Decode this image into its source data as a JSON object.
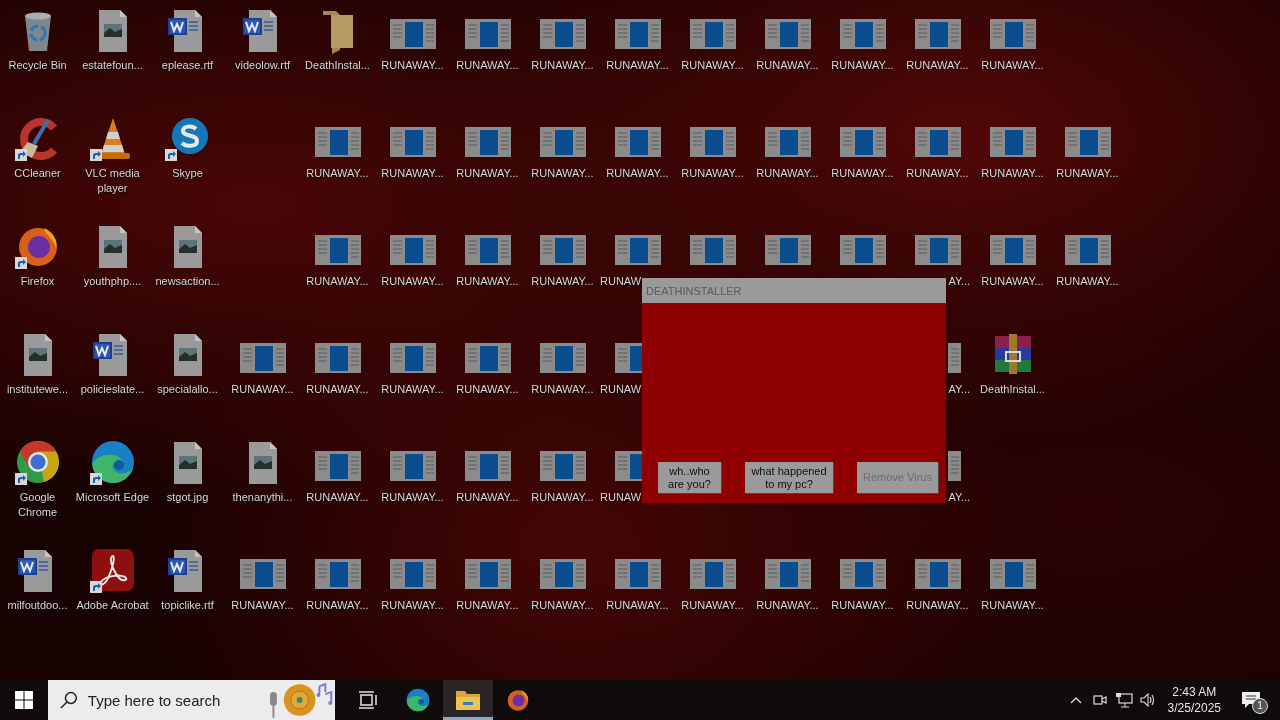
{
  "desktop": {
    "rows": [
      [
        {
          "kind": "recycle",
          "label": "Recycle Bin"
        },
        {
          "kind": "image",
          "label": "estatefoun..."
        },
        {
          "kind": "word",
          "label": "eplease.rtf"
        },
        {
          "kind": "word",
          "label": "videolow.rtf"
        },
        {
          "kind": "folder",
          "label": "DeathInstal..."
        },
        {
          "kind": "app-window",
          "label": "RUNAWAY..."
        },
        {
          "kind": "app-window",
          "label": "RUNAWAY..."
        },
        {
          "kind": "app-window",
          "label": "RUNAWAY..."
        },
        {
          "kind": "app-window",
          "label": "RUNAWAY..."
        },
        {
          "kind": "app-window",
          "label": "RUNAWAY..."
        },
        {
          "kind": "app-window",
          "label": "RUNAWAY..."
        },
        {
          "kind": "app-window",
          "label": "RUNAWAY..."
        },
        {
          "kind": "app-window",
          "label": "RUNAWAY..."
        },
        {
          "kind": "app-window",
          "label": "RUNAWAY..."
        }
      ],
      [
        {
          "kind": "ccleaner",
          "label": "CCleaner",
          "shortcut": true
        },
        {
          "kind": "vlc",
          "label": "VLC media player",
          "shortcut": true
        },
        {
          "kind": "skype",
          "label": "Skype",
          "shortcut": true
        },
        {
          "kind": "gap"
        },
        {
          "kind": "app-window",
          "label": "RUNAWAY..."
        },
        {
          "kind": "app-window",
          "label": "RUNAWAY..."
        },
        {
          "kind": "app-window",
          "label": "RUNAWAY..."
        },
        {
          "kind": "app-window",
          "label": "RUNAWAY..."
        },
        {
          "kind": "app-window",
          "label": "RUNAWAY..."
        },
        {
          "kind": "app-window",
          "label": "RUNAWAY..."
        },
        {
          "kind": "app-window",
          "label": "RUNAWAY..."
        },
        {
          "kind": "app-window",
          "label": "RUNAWAY..."
        },
        {
          "kind": "app-window",
          "label": "RUNAWAY..."
        },
        {
          "kind": "app-window",
          "label": "RUNAWAY..."
        },
        {
          "kind": "app-window",
          "label": "RUNAWAY..."
        }
      ],
      [
        {
          "kind": "firefox",
          "label": "Firefox",
          "shortcut": true
        },
        {
          "kind": "image",
          "label": "youthphp...."
        },
        {
          "kind": "image",
          "label": "newsaction..."
        },
        {
          "kind": "gap"
        },
        {
          "kind": "app-window",
          "label": "RUNAWAY..."
        },
        {
          "kind": "app-window",
          "label": "RUNAWAY..."
        },
        {
          "kind": "app-window",
          "label": "RUNAWAY..."
        },
        {
          "kind": "app-window",
          "label": "RUNAWAY..."
        },
        {
          "kind": "app-window",
          "label": "RUNAW",
          "label_clip_end": true
        },
        {
          "kind": "app-window"
        },
        {
          "kind": "app-window"
        },
        {
          "kind": "app-window"
        },
        {
          "kind": "app-window",
          "label": "AY...",
          "label_clip_start": true
        },
        {
          "kind": "app-window",
          "label": "RUNAWAY..."
        },
        {
          "kind": "app-window",
          "label": "RUNAWAY..."
        }
      ],
      [
        {
          "kind": "image",
          "label": "institutewe..."
        },
        {
          "kind": "word",
          "label": "policieslate..."
        },
        {
          "kind": "image",
          "label": "specialallo..."
        },
        {
          "kind": "app-window",
          "label": "RUNAWAY..."
        },
        {
          "kind": "app-window",
          "label": "RUNAWAY..."
        },
        {
          "kind": "app-window",
          "label": "RUNAWAY..."
        },
        {
          "kind": "app-window",
          "label": "RUNAWAY..."
        },
        {
          "kind": "app-window",
          "label": "RUNAWAY..."
        },
        {
          "kind": "app-window",
          "label": "RUNAW",
          "label_clip_end": true,
          "icon_clip_end": true
        },
        {
          "kind": "gap"
        },
        {
          "kind": "gap"
        },
        {
          "kind": "gap"
        },
        {
          "kind": "app-window",
          "label": "AY...",
          "label_clip_start": true,
          "icon_clip_start": true
        },
        {
          "kind": "winrar",
          "label": "DeathInstal..."
        }
      ],
      [
        {
          "kind": "chrome",
          "label": "Google Chrome",
          "shortcut": true
        },
        {
          "kind": "edge",
          "label": "Microsoft Edge",
          "shortcut": true
        },
        {
          "kind": "image",
          "label": "stgot.jpg"
        },
        {
          "kind": "image",
          "label": "thenanythi..."
        },
        {
          "kind": "app-window",
          "label": "RUNAWAY..."
        },
        {
          "kind": "app-window",
          "label": "RUNAWAY..."
        },
        {
          "kind": "app-window",
          "label": "RUNAWAY..."
        },
        {
          "kind": "app-window",
          "label": "RUNAWAY..."
        },
        {
          "kind": "app-window",
          "label": "RUNAW",
          "label_clip_end": true,
          "icon_clip_end": true
        },
        {
          "kind": "gap"
        },
        {
          "kind": "gap"
        },
        {
          "kind": "gap"
        },
        {
          "kind": "app-window",
          "label": "AY...",
          "label_clip_start": true,
          "icon_clip_start": true
        }
      ],
      [
        {
          "kind": "word",
          "label": "milfoutdoo..."
        },
        {
          "kind": "acrobat",
          "label": "Adobe Acrobat",
          "shortcut": true
        },
        {
          "kind": "word",
          "label": "topiclike.rtf"
        },
        {
          "kind": "app-window",
          "label": "RUNAWAY..."
        },
        {
          "kind": "app-window",
          "label": "RUNAWAY..."
        },
        {
          "kind": "app-window",
          "label": "RUNAWAY..."
        },
        {
          "kind": "app-window",
          "label": "RUNAWAY..."
        },
        {
          "kind": "app-window",
          "label": "RUNAWAY..."
        },
        {
          "kind": "app-window",
          "label": "RUNAWAY..."
        },
        {
          "kind": "app-window",
          "label": "RUNAWAY..."
        },
        {
          "kind": "app-window",
          "label": "RUNAWAY..."
        },
        {
          "kind": "app-window",
          "label": "RUNAWAY..."
        },
        {
          "kind": "app-window",
          "label": "RUNAWAY..."
        },
        {
          "kind": "app-window",
          "label": "RUNAWAY..."
        }
      ]
    ]
  },
  "dialog": {
    "title": "DEATHINSTALLER",
    "buttons": [
      {
        "label": "wh..who are you?",
        "disabled": false
      },
      {
        "label": "what happened to my pc?",
        "disabled": false
      },
      {
        "label": "Remove Virus",
        "disabled": true
      }
    ]
  },
  "taskbar": {
    "search": {
      "placeholder": "Type here to search"
    },
    "apps": [
      {
        "kind": "task-view",
        "running": false
      },
      {
        "kind": "edge",
        "running": false
      },
      {
        "kind": "explorer",
        "running": true
      },
      {
        "kind": "firefox",
        "running": false
      }
    ],
    "tray": {
      "time": "2:43 AM",
      "date": "3/25/2025",
      "notifications": "1"
    }
  }
}
